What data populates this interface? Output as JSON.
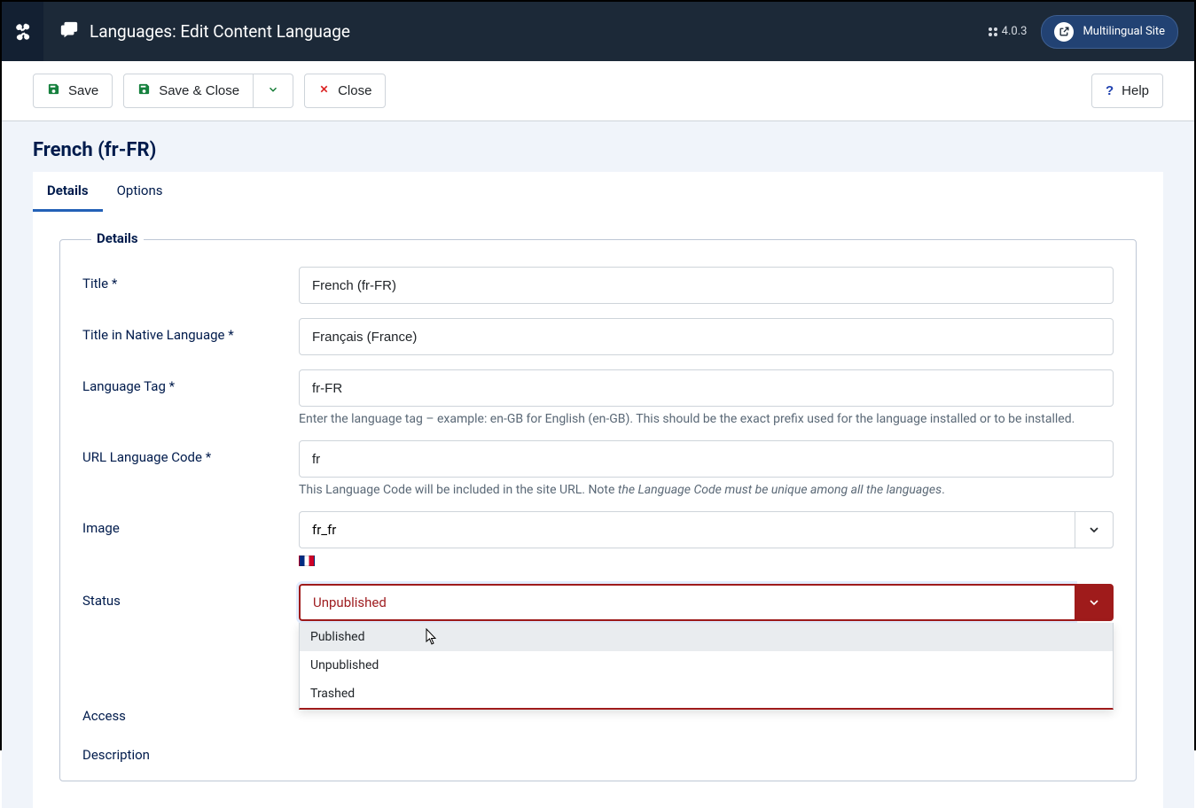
{
  "header": {
    "title": "Languages: Edit Content Language",
    "version": "4.0.3",
    "site_link": "Multilingual Site"
  },
  "toolbar": {
    "save": "Save",
    "save_close": "Save & Close",
    "close": "Close",
    "help": "Help"
  },
  "page": {
    "title": "French (fr-FR)"
  },
  "tabs": [
    {
      "label": "Details",
      "active": true
    },
    {
      "label": "Options",
      "active": false
    }
  ],
  "fieldset_legend": "Details",
  "fields": {
    "title": {
      "label": "Title *",
      "value": "French (fr-FR)"
    },
    "native": {
      "label": "Title in Native Language *",
      "value": "Français (France)"
    },
    "lang_tag": {
      "label": "Language Tag *",
      "value": "fr-FR",
      "help": "Enter the language tag – example: en-GB for English (en-GB). This should be the exact prefix used for the language installed or to be installed."
    },
    "url_code": {
      "label": "URL Language Code *",
      "value": "fr",
      "help_prefix": "This Language Code will be included in the site URL. Note ",
      "help_em": "the Language Code must be unique among all the languages",
      "help_suffix": "."
    },
    "image": {
      "label": "Image",
      "value": "fr_fr"
    },
    "status": {
      "label": "Status",
      "value": "Unpublished",
      "options": [
        "Published",
        "Unpublished",
        "Trashed"
      ]
    },
    "access": {
      "label": "Access"
    },
    "description": {
      "label": "Description"
    }
  }
}
